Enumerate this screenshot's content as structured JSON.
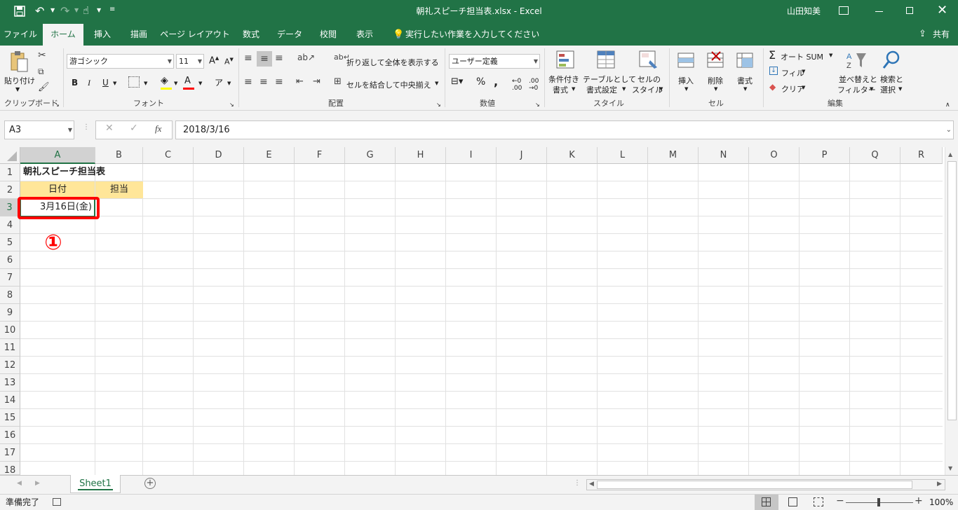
{
  "title": {
    "document": "朝礼スピーチ担当表.xlsx  -  Excel",
    "user": "山田知美",
    "share": "共有",
    "search_placeholder": "実行したい作業を入力してください"
  },
  "tabs": [
    "ファイル",
    "ホーム",
    "挿入",
    "描画",
    "ページ レイアウト",
    "数式",
    "データ",
    "校閲",
    "表示"
  ],
  "ribbon": {
    "clipboard": {
      "paste": "貼り付け",
      "label": "クリップボード"
    },
    "font": {
      "name": "游ゴシック",
      "size": "11",
      "bold": "B",
      "italic": "I",
      "underline": "U",
      "label": "フォント"
    },
    "alignment": {
      "wrap": "折り返して全体を表示する",
      "merge": "セルを結合して中央揃え",
      "label": "配置"
    },
    "number": {
      "format": "ユーザー定義",
      "percent": "%",
      "comma": ",",
      "label": "数値"
    },
    "styles": {
      "cond1": "条件付き",
      "cond2": "書式",
      "table1": "テーブルとして",
      "table2": "書式設定",
      "cell1": "セルの",
      "cell2": "スタイル",
      "label": "スタイル"
    },
    "cells": {
      "insert": "挿入",
      "delete": "削除",
      "format": "書式",
      "label": "セル"
    },
    "editing": {
      "autosum": "オート SUM",
      "fill": "フィル",
      "clear": "クリア",
      "sort1": "並べ替えと",
      "sort2": "フィルター",
      "find1": "検索と",
      "find2": "選択",
      "label": "編集"
    }
  },
  "formula": {
    "namebox": "A3",
    "fx": "fx",
    "value": "2018/3/16"
  },
  "columns": [
    "A",
    "B",
    "C",
    "D",
    "E",
    "F",
    "G",
    "H",
    "I",
    "J",
    "K",
    "L",
    "M",
    "N",
    "O",
    "P",
    "Q",
    "R"
  ],
  "rows": [
    "1",
    "2",
    "3",
    "4",
    "5",
    "6",
    "7",
    "8",
    "9",
    "10",
    "11",
    "12",
    "13",
    "14",
    "15",
    "16",
    "17",
    "18"
  ],
  "cells": {
    "a1": "朝礼スピーチ担当表",
    "a2": "日付",
    "b2": "担当",
    "a3": "3月16日(金)"
  },
  "annotation": "①",
  "sheet": {
    "name": "Sheet1",
    "add": "+"
  },
  "status": {
    "ready": "準備完了",
    "zoom": "100%"
  },
  "colors": {
    "accent": "#217346",
    "header_fill": "#ffe699",
    "highlight": "#ff0000"
  }
}
